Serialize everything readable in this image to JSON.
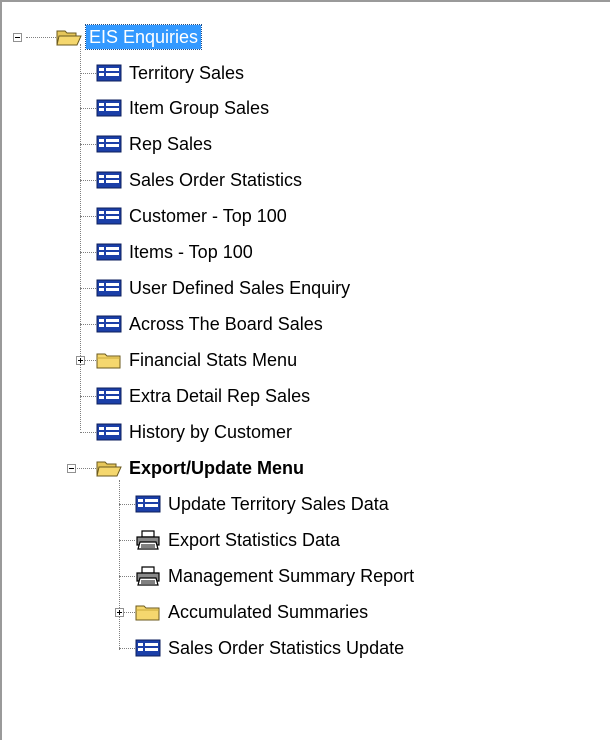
{
  "tree": {
    "root": {
      "label": "EIS Enquiries",
      "icon": "folder-open-icon",
      "expanded": true,
      "selected": true
    },
    "items": [
      {
        "label": "Territory Sales",
        "icon": "form-icon"
      },
      {
        "label": "Item Group Sales",
        "icon": "form-icon"
      },
      {
        "label": "Rep Sales",
        "icon": "form-icon"
      },
      {
        "label": "Sales Order Statistics",
        "icon": "form-icon"
      },
      {
        "label": "Customer - Top 100",
        "icon": "form-icon"
      },
      {
        "label": "Items - Top 100",
        "icon": "form-icon"
      },
      {
        "label": "User Defined Sales Enquiry",
        "icon": "form-icon"
      },
      {
        "label": "Across The Board Sales",
        "icon": "form-icon"
      },
      {
        "label": "Financial Stats Menu",
        "icon": "folder-closed-icon",
        "expanded": false
      },
      {
        "label": "Extra Detail Rep Sales",
        "icon": "form-icon"
      },
      {
        "label": "History by Customer",
        "icon": "form-icon"
      },
      {
        "label": "Export/Update Menu",
        "icon": "folder-open-icon",
        "expanded": true,
        "children": [
          {
            "label": "Update Territory Sales Data",
            "icon": "form-icon"
          },
          {
            "label": "Export Statistics Data",
            "icon": "printer-icon"
          },
          {
            "label": "Management Summary Report",
            "icon": "printer-icon"
          },
          {
            "label": "Accumulated Summaries",
            "icon": "folder-closed-icon",
            "expanded": false
          },
          {
            "label": "Sales Order Statistics Update",
            "icon": "form-icon"
          }
        ]
      }
    ]
  },
  "colors": {
    "selection_bg": "#3399ff",
    "selection_text": "#ffffff",
    "tree_lines": "#808080",
    "form_icon_blue": "#1b3fa8",
    "folder_yellow": "#f5d76e"
  }
}
